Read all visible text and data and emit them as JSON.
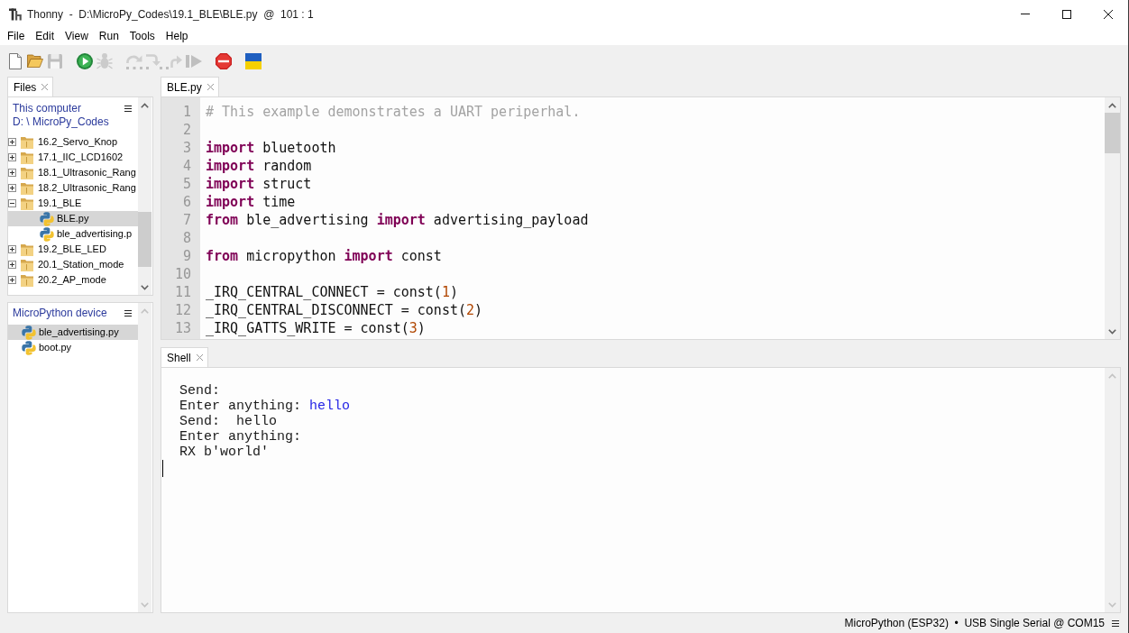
{
  "window": {
    "title": "Thonny  -  D:\\MicroPy_Codes\\19.1_BLE\\BLE.py  @  101 : 1"
  },
  "menu": [
    "File",
    "Edit",
    "View",
    "Run",
    "Tools",
    "Help"
  ],
  "toolbar": {
    "groups": [
      {
        "buttons": [
          {
            "kind": "new",
            "disabled": false
          },
          {
            "kind": "open",
            "disabled": false
          },
          {
            "kind": "save",
            "disabled": true
          }
        ]
      },
      {
        "buttons": [
          {
            "kind": "run",
            "disabled": false
          },
          {
            "kind": "debug",
            "disabled": true
          }
        ]
      },
      {
        "buttons": [
          {
            "kind": "stepover",
            "disabled": true
          },
          {
            "kind": "stepinto",
            "disabled": true
          },
          {
            "kind": "stepout",
            "disabled": true
          },
          {
            "kind": "resume",
            "disabled": true
          }
        ]
      },
      {
        "buttons": [
          {
            "kind": "stop",
            "disabled": false
          }
        ]
      },
      {
        "buttons": [
          {
            "kind": "flag",
            "disabled": false
          }
        ]
      }
    ]
  },
  "files_panel": {
    "tabs": [
      {
        "label": "Files",
        "selected": true
      }
    ],
    "location": {
      "title": "This computer",
      "path": "D: \\ MicroPy_Codes"
    },
    "items": [
      {
        "label": "16.2_Servo_Knop",
        "kind": "folder",
        "expanded": false,
        "selected": false
      },
      {
        "label": "17.1_IIC_LCD1602",
        "kind": "folder",
        "expanded": false,
        "selected": false
      },
      {
        "label": "18.1_Ultrasonic_Rang",
        "kind": "folder",
        "expanded": false,
        "selected": false
      },
      {
        "label": "18.2_Ultrasonic_Rang",
        "kind": "folder",
        "expanded": false,
        "selected": false
      },
      {
        "label": "19.1_BLE",
        "kind": "folder",
        "expanded": true,
        "selected": false,
        "children": [
          {
            "label": "BLE.py",
            "kind": "file",
            "selected": true
          },
          {
            "label": "ble_advertising.p",
            "kind": "file",
            "selected": false
          }
        ]
      },
      {
        "label": "19.2_BLE_LED",
        "kind": "folder",
        "expanded": false,
        "selected": false
      },
      {
        "label": "20.1_Station_mode",
        "kind": "folder",
        "expanded": false,
        "selected": false
      },
      {
        "label": "20.2_AP_mode",
        "kind": "folder",
        "expanded": false,
        "selected": false
      }
    ]
  },
  "device_panel": {
    "title": "MicroPython device",
    "items": [
      {
        "label": "ble_advertising.py",
        "kind": "file",
        "selected": true
      },
      {
        "label": "boot.py",
        "kind": "file",
        "selected": false
      }
    ]
  },
  "editor": {
    "tabs": [
      {
        "label": "BLE.py",
        "selected": true
      }
    ],
    "lines": [
      {
        "number": "1",
        "tokens": [
          {
            "kind": "comment",
            "text": "# This example demonstrates a UART periperhal."
          }
        ]
      },
      {
        "number": "2"
      },
      {
        "number": "3",
        "tokens": [
          {
            "kind": "keyword",
            "text": "import"
          },
          {
            "kind": "text",
            "text": " bluetooth"
          }
        ]
      },
      {
        "number": "4",
        "tokens": [
          {
            "kind": "keyword",
            "text": "import"
          },
          {
            "kind": "text",
            "text": " random"
          }
        ]
      },
      {
        "number": "5",
        "tokens": [
          {
            "kind": "keyword",
            "text": "import"
          },
          {
            "kind": "text",
            "text": " struct"
          }
        ]
      },
      {
        "number": "6",
        "tokens": [
          {
            "kind": "keyword",
            "text": "import"
          },
          {
            "kind": "text",
            "text": " time"
          }
        ]
      },
      {
        "number": "7",
        "tokens": [
          {
            "kind": "keyword",
            "text": "from"
          },
          {
            "kind": "text",
            "text": " ble_advertising "
          },
          {
            "kind": "keyword",
            "text": "import"
          },
          {
            "kind": "text",
            "text": " advertising_payload"
          }
        ]
      },
      {
        "number": "8"
      },
      {
        "number": "9",
        "tokens": [
          {
            "kind": "keyword",
            "text": "from"
          },
          {
            "kind": "text",
            "text": " micropython "
          },
          {
            "kind": "keyword",
            "text": "import"
          },
          {
            "kind": "text",
            "text": " const"
          }
        ]
      },
      {
        "number": "10"
      },
      {
        "number": "11",
        "tokens": [
          {
            "kind": "text",
            "text": "_IRQ_CENTRAL_CONNECT = const("
          },
          {
            "kind": "number",
            "text": "1"
          },
          {
            "kind": "text",
            "text": ")"
          }
        ]
      },
      {
        "number": "12",
        "tokens": [
          {
            "kind": "text",
            "text": "_IRQ_CENTRAL_DISCONNECT = const("
          },
          {
            "kind": "number",
            "text": "2"
          },
          {
            "kind": "text",
            "text": ")"
          }
        ]
      },
      {
        "number": "13",
        "tokens": [
          {
            "kind": "text",
            "text": "_IRQ_GATTS_WRITE = const("
          },
          {
            "kind": "number",
            "text": "3"
          },
          {
            "kind": "text",
            "text": ")"
          }
        ]
      }
    ]
  },
  "shell": {
    "tabs": [
      {
        "label": "Shell",
        "selected": true
      }
    ],
    "lines": [
      [
        {
          "kind": "output",
          "text": "Send:"
        }
      ],
      [
        {
          "kind": "output",
          "text": "Enter anything: "
        },
        {
          "kind": "input",
          "text": "hello"
        }
      ],
      [
        {
          "kind": "output",
          "text": "Send:  hello"
        }
      ],
      [
        {
          "kind": "output",
          "text": "Enter anything:"
        }
      ],
      [
        {
          "kind": "output",
          "text": "RX b'world'"
        }
      ]
    ]
  },
  "status_bar": {
    "text": "MicroPython (ESP32)  •  USB Single Serial @ COM15"
  }
}
